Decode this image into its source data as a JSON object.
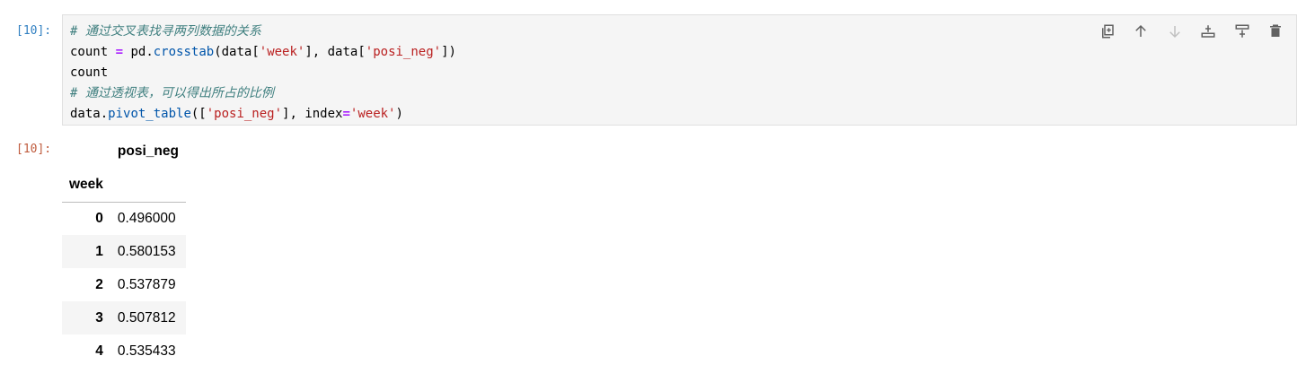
{
  "cell": {
    "input_prompt": "[10]:",
    "output_prompt": "[10]:",
    "code_lines": [
      [
        {
          "t": "comment",
          "v": "# 通过交叉表找寻两列数据的关系"
        }
      ],
      [
        {
          "t": "plain",
          "v": "count "
        },
        {
          "t": "op",
          "v": "="
        },
        {
          "t": "plain",
          "v": " pd"
        },
        {
          "t": "plain",
          "v": "."
        },
        {
          "t": "func",
          "v": "crosstab"
        },
        {
          "t": "plain",
          "v": "(data["
        },
        {
          "t": "string",
          "v": "'week'"
        },
        {
          "t": "plain",
          "v": "], data["
        },
        {
          "t": "string",
          "v": "'posi_neg'"
        },
        {
          "t": "plain",
          "v": "])"
        }
      ],
      [
        {
          "t": "plain",
          "v": "count"
        }
      ],
      [
        {
          "t": "comment",
          "v": "# 通过透视表，可以得出所占的比例"
        }
      ],
      [
        {
          "t": "plain",
          "v": "data"
        },
        {
          "t": "plain",
          "v": "."
        },
        {
          "t": "func",
          "v": "pivot_table"
        },
        {
          "t": "plain",
          "v": "(["
        },
        {
          "t": "string",
          "v": "'posi_neg'"
        },
        {
          "t": "plain",
          "v": "], index"
        },
        {
          "t": "op",
          "v": "="
        },
        {
          "t": "string",
          "v": "'week'"
        },
        {
          "t": "plain",
          "v": ")"
        }
      ]
    ],
    "toolbar": [
      {
        "name": "duplicate-cell-button",
        "icon": "duplicate-icon",
        "disabled": false
      },
      {
        "name": "move-cell-up-button",
        "icon": "arrow-up-icon",
        "disabled": false
      },
      {
        "name": "move-cell-down-button",
        "icon": "arrow-down-icon",
        "disabled": true
      },
      {
        "name": "insert-cell-above-button",
        "icon": "insert-above-icon",
        "disabled": false
      },
      {
        "name": "insert-cell-below-button",
        "icon": "insert-below-icon",
        "disabled": false
      },
      {
        "name": "delete-cell-button",
        "icon": "trash-icon",
        "disabled": false
      }
    ]
  },
  "output_table": {
    "column_header": "posi_neg",
    "index_name": "week",
    "rows": [
      {
        "index": "0",
        "value": "0.496000"
      },
      {
        "index": "1",
        "value": "0.580153"
      },
      {
        "index": "2",
        "value": "0.537879"
      },
      {
        "index": "3",
        "value": "0.507812"
      },
      {
        "index": "4",
        "value": "0.535433"
      }
    ]
  },
  "colors": {
    "input_prompt": "#307fc1",
    "output_prompt": "#bf5b3d",
    "comment": "#3f7f7f",
    "string": "#ba2121",
    "function": "#0055aa",
    "operator": "#aa22ff",
    "cell_background": "#f5f5f5"
  }
}
